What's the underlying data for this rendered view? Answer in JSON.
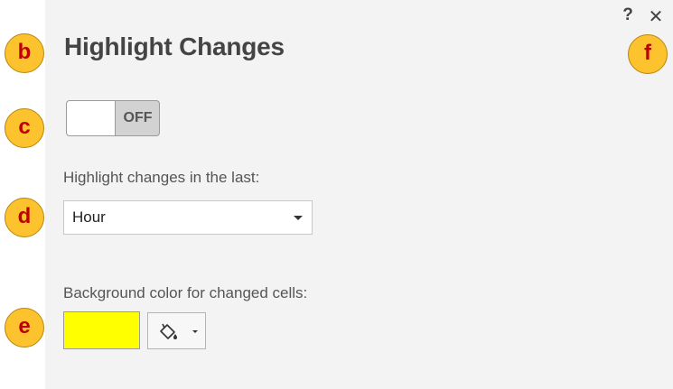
{
  "panel": {
    "title": "Highlight Changes",
    "help_glyph": "?",
    "close_glyph": "✕"
  },
  "toggle": {
    "state_label": "OFF",
    "on": false
  },
  "interval": {
    "label": "Highlight changes in the last:",
    "selected": "Hour"
  },
  "background_color": {
    "label": "Background color for changed cells:",
    "value": "#ffff00",
    "picker_icon": "paint-bucket-icon"
  },
  "callouts": [
    {
      "letter": "b"
    },
    {
      "letter": "c"
    },
    {
      "letter": "d"
    },
    {
      "letter": "e"
    },
    {
      "letter": "f"
    }
  ],
  "colors": {
    "callout_fill": "#fcc32e",
    "callout_text": "#c00000",
    "panel_bg": "#f3f3f3"
  }
}
